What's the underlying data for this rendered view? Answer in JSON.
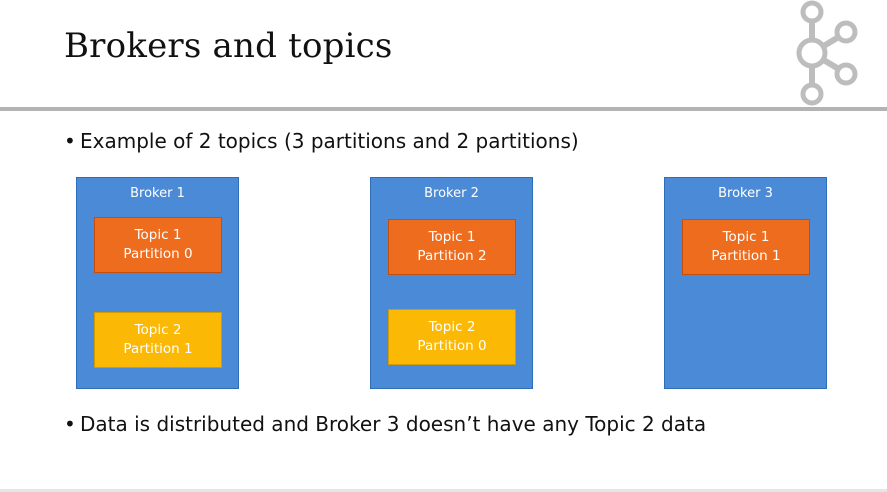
{
  "title": "Brokers and topics",
  "bullets": [
    "Example of 2 topics (3 partitions and 2 partitions)",
    "Data is distributed and Broker 3 doesn’t have any Topic 2 data"
  ],
  "bullet_symbol": "•",
  "colors": {
    "broker": "#4a8ad6",
    "topic1": "#ee6c1e",
    "topic2": "#fbb804",
    "rule": "#b3b3b3"
  },
  "brokers": [
    {
      "label": "Broker 1",
      "partitions": [
        {
          "topic": "Topic 1",
          "partition": "Partition 0"
        },
        {
          "topic": "Topic 2",
          "partition": "Partition 1"
        }
      ]
    },
    {
      "label": "Broker 2",
      "partitions": [
        {
          "topic": "Topic 1",
          "partition": "Partition 2"
        },
        {
          "topic": "Topic 2",
          "partition": "Partition 0"
        }
      ]
    },
    {
      "label": "Broker 3",
      "partitions": [
        {
          "topic": "Topic 1",
          "partition": "Partition 1"
        }
      ]
    }
  ],
  "logo_icon": "kafka-logo-icon"
}
